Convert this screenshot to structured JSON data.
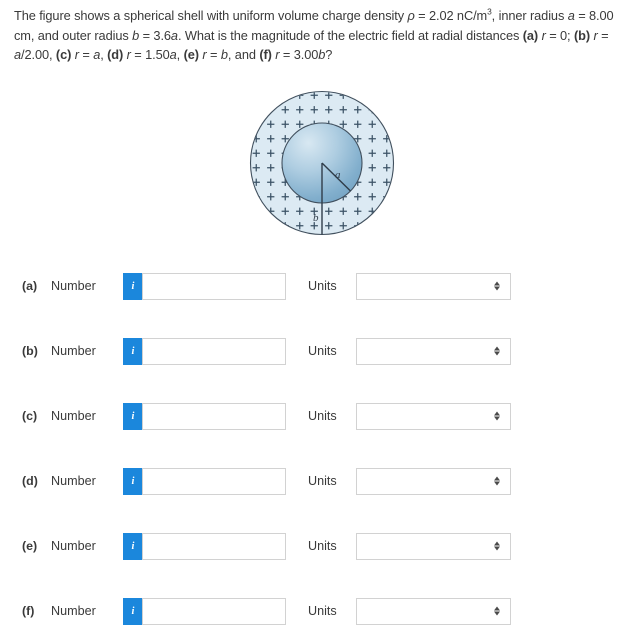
{
  "question": {
    "segments": [
      {
        "t": "The figure shows a spherical shell with uniform volume charge density "
      },
      {
        "t": "ρ",
        "style": "ital"
      },
      {
        "t": " = 2.02 nC/m"
      },
      {
        "t": "3",
        "style": "sup"
      },
      {
        "t": ", inner radius "
      },
      {
        "t": "a",
        "style": "ital"
      },
      {
        "t": " = 8.00 cm, and outer radius "
      },
      {
        "t": "b",
        "style": "ital"
      },
      {
        "t": " = 3.6"
      },
      {
        "t": "a",
        "style": "ital"
      },
      {
        "t": ". What is the magnitude of the electric field at radial distances "
      },
      {
        "t": "(a)",
        "style": "bold"
      },
      {
        "t": " "
      },
      {
        "t": "r",
        "style": "ital"
      },
      {
        "t": " = 0; "
      },
      {
        "t": "(b)",
        "style": "bold"
      },
      {
        "t": " "
      },
      {
        "t": "r",
        "style": "ital"
      },
      {
        "t": " = "
      },
      {
        "t": "a",
        "style": "ital"
      },
      {
        "t": "/2.00, "
      },
      {
        "t": "(c)",
        "style": "bold"
      },
      {
        "t": " "
      },
      {
        "t": "r",
        "style": "ital"
      },
      {
        "t": " = "
      },
      {
        "t": "a",
        "style": "ital"
      },
      {
        "t": ", "
      },
      {
        "t": "(d)",
        "style": "bold"
      },
      {
        "t": " "
      },
      {
        "t": "r",
        "style": "ital"
      },
      {
        "t": " = 1.50"
      },
      {
        "t": "a",
        "style": "ital"
      },
      {
        "t": ", "
      },
      {
        "t": "(e)",
        "style": "bold"
      },
      {
        "t": " "
      },
      {
        "t": "r",
        "style": "ital"
      },
      {
        "t": " = "
      },
      {
        "t": "b",
        "style": "ital"
      },
      {
        "t": ", and "
      },
      {
        "t": "(f)",
        "style": "bold"
      },
      {
        "t": " "
      },
      {
        "t": "r",
        "style": "ital"
      },
      {
        "t": " = 3.00"
      },
      {
        "t": "b",
        "style": "ital"
      },
      {
        "t": "?"
      }
    ],
    "plain": "The figure shows a spherical shell with uniform volume charge density ρ = 2.02 nC/m3, inner radius a = 8.00 cm, and outer radius b = 3.6a. What is the magnitude of the electric field at radial distances (a) r = 0; (b) r = a/2.00, (c) r = a, (d) r = 1.50a, (e) r = b, and (f) r = 3.00b?"
  },
  "figure": {
    "name": "spherical-shell-diagram",
    "inner_radius_label": "a",
    "outer_radius_label": "b",
    "charge_symbol": "+",
    "colors": {
      "shell_fill": "#dceaf3",
      "shell_stroke": "#3c4b5a",
      "core_gradient_light": "#cfe2ee",
      "core_gradient_dark": "#6e9fc0",
      "plus_color": "#3b5266"
    }
  },
  "answers": {
    "number_label": "Number",
    "units_label": "Units",
    "info_glyph": "i",
    "input_value": "",
    "input_placeholder": "",
    "units_value": "",
    "rows": [
      {
        "letter": "(a)"
      },
      {
        "letter": "(b)"
      },
      {
        "letter": "(c)"
      },
      {
        "letter": "(d)"
      },
      {
        "letter": "(e)"
      },
      {
        "letter": "(f)"
      }
    ]
  }
}
